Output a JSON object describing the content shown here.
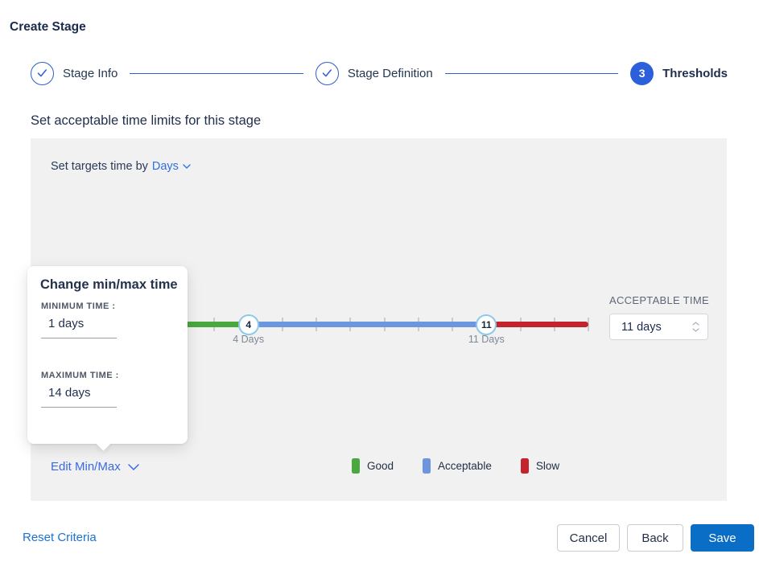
{
  "page": {
    "title": "Create Stage"
  },
  "stepper": {
    "steps": [
      {
        "label": "Stage Info",
        "state": "complete"
      },
      {
        "label": "Stage Definition",
        "state": "complete"
      },
      {
        "label": "Thresholds",
        "state": "active",
        "number": "3"
      }
    ]
  },
  "section": {
    "heading": "Set acceptable time limits for this stage"
  },
  "panel": {
    "targets_label": "Set targets time by",
    "targets_value": "Days",
    "slider": {
      "min": 1,
      "max": 14,
      "unit": "Days",
      "markers": [
        {
          "value": 4,
          "label": "4 Days"
        },
        {
          "value": 11,
          "label": "11 Days"
        }
      ],
      "segments": [
        {
          "name": "good",
          "color": "#4aa83e"
        },
        {
          "name": "acceptable",
          "color": "#6d96e0"
        },
        {
          "name": "slow",
          "color": "#c5232b"
        }
      ]
    },
    "acceptable_time": {
      "label": "ACCEPTABLE TIME",
      "value": "11 days"
    },
    "edit_minmax_label": "Edit Min/Max",
    "legend": [
      {
        "label": "Good",
        "color": "#4aa83e"
      },
      {
        "label": "Acceptable",
        "color": "#6d96e0"
      },
      {
        "label": "Slow",
        "color": "#c5232b"
      }
    ]
  },
  "popup": {
    "title": "Change min/max time",
    "min_label": "MINIMUM TIME :",
    "min_value": "1 days",
    "max_label": "MAXIMUM TIME :",
    "max_value": "14 days"
  },
  "footer": {
    "reset_label": "Reset Criteria",
    "cancel_label": "Cancel",
    "back_label": "Back",
    "save_label": "Save"
  },
  "colors": {
    "stepper_blue": "#2e5ed0",
    "active_step_blue": "#2b60da",
    "link_blue": "#2f6fe5",
    "save_blue": "#0b6ec6",
    "good_green": "#4aa83e",
    "acceptable_blue": "#6d96e0",
    "slow_red": "#c5232b",
    "panel_bg": "#f1f1f2",
    "marker_ring": "#8ec9e9"
  }
}
